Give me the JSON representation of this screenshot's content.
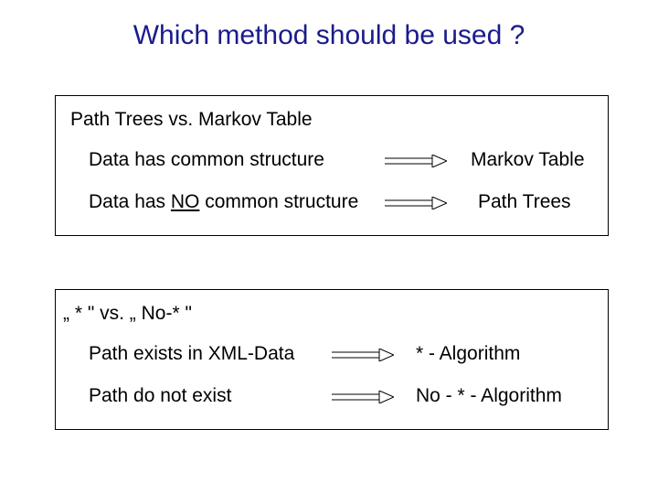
{
  "title": "Which method should be used ?",
  "box1": {
    "heading": "Path Trees vs. Markov Table",
    "row1": {
      "left_pre": "Data has common structure",
      "result": "Markov Table"
    },
    "row2": {
      "left_pre": "Data has ",
      "left_emph": "NO",
      "left_post": " common structure",
      "result": "Path Trees"
    }
  },
  "box2": {
    "heading": "„ * \"   vs.  „ No-* \"",
    "row1": {
      "left_pre": "Path exists in XML-Data",
      "result": "* - Algorithm"
    },
    "row2": {
      "left_pre": "Path do not exist",
      "result": "No - * - Algorithm"
    }
  }
}
